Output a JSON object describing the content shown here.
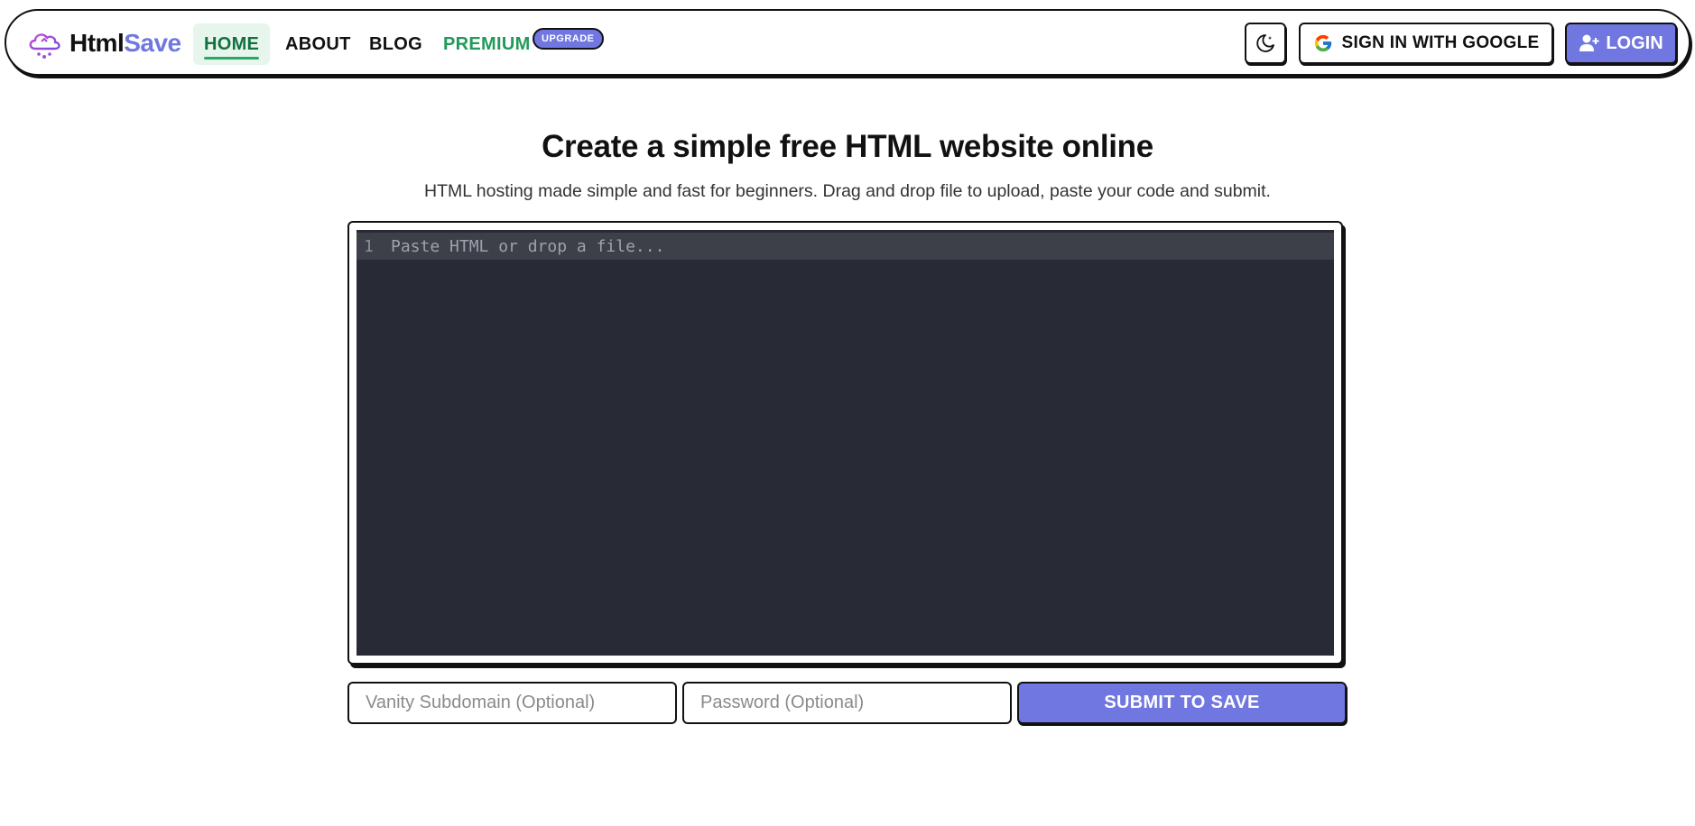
{
  "nav": {
    "logo_part1": "Html",
    "logo_part2": "Save",
    "links": [
      {
        "label": "HOME",
        "active": true
      },
      {
        "label": "ABOUT"
      },
      {
        "label": "BLOG"
      },
      {
        "label": "PREMIUM"
      }
    ],
    "badge": "UPGRADE",
    "theme_icon": "moon-icon",
    "google_label": "SIGN IN WITH GOOGLE",
    "login_label": "LOGIN"
  },
  "hero": {
    "title": "Create a simple free HTML website online",
    "subtitle": "HTML hosting made simple and fast for beginners. Drag and drop file to upload, paste your code and submit."
  },
  "editor": {
    "line_number": "1",
    "placeholder": "Paste HTML or drop a file..."
  },
  "form": {
    "vanity_placeholder": "Vanity Subdomain (Optional)",
    "password_placeholder": "Password (Optional)",
    "submit_label": "SUBMIT TO SAVE"
  },
  "colors": {
    "accent": "#7077e0",
    "green": "#219a5a",
    "editor_bg": "#282a36"
  }
}
